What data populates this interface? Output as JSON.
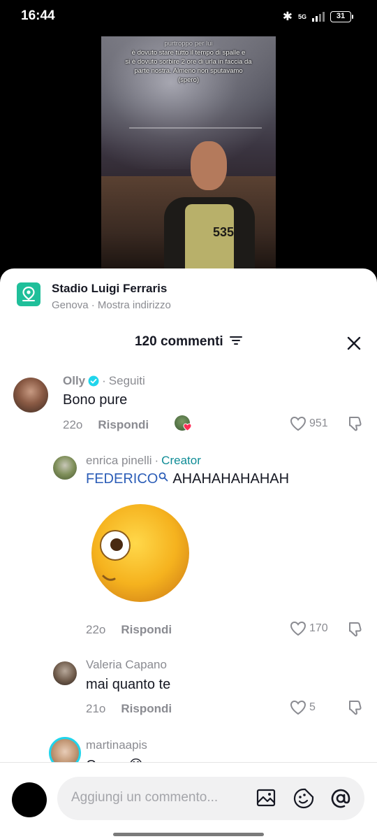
{
  "status": {
    "time": "16:44",
    "network": "5G",
    "battery": "31"
  },
  "video": {
    "caption_lines": [
      "purtroppo per lui",
      "è dovuto stare tutto il tempo di spalle e",
      "si è dovuto sorbire 2 ore di urla in faccia da",
      "parte nostra. Almeno non sputavamo",
      "(spero)"
    ],
    "shirt_number": "535"
  },
  "location": {
    "title": "Stadio Luigi Ferraris",
    "subtitle": "Genova · Mostra indirizzo"
  },
  "comments_header": {
    "title": "120 commenti"
  },
  "comments": [
    {
      "author": "Olly",
      "verified": true,
      "relation": "Seguiti",
      "text": "Bono pure",
      "time": "22o",
      "reply": "Rispondi",
      "likes": "951"
    },
    {
      "author": "enrica pinelli",
      "role": "Creator",
      "mention": "FEDERICO",
      "text": "AHAHAHAHAHAH",
      "time": "22o",
      "reply": "Rispondi",
      "likes": "170"
    },
    {
      "author": "Valeria Capano",
      "text": "mai quanto te",
      "time": "21o",
      "reply": "Rispondi",
      "likes": "5"
    },
    {
      "author": "martinaapis",
      "text": "Crepo 😂"
    }
  ],
  "composer": {
    "placeholder": "Aggiungi un commento..."
  }
}
